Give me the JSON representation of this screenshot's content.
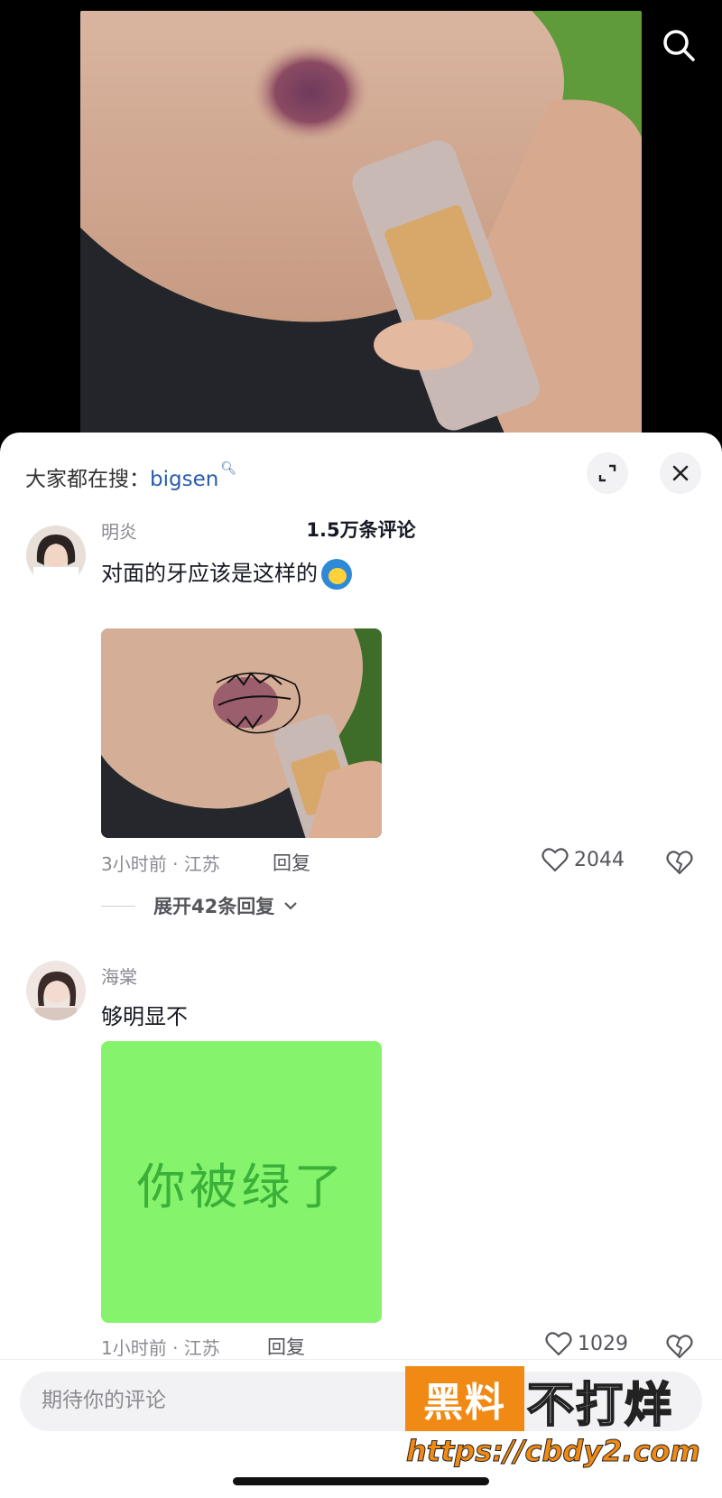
{
  "trending": {
    "prefix": "大家都在搜：",
    "keyword": "bigsen"
  },
  "comments_count": "1.5万条评论",
  "comments": [
    {
      "username": "明炎",
      "text": "对面的牙应该是这样的",
      "time_location": "3小时前 · 江苏",
      "reply_label": "回复",
      "likes": "2044",
      "expand_replies": "展开42条回复"
    },
    {
      "username": "海棠",
      "text": "够明显不",
      "image_text": "你被绿了",
      "time_location": "1小时前 · 江苏",
      "reply_label": "回复",
      "likes": "1029"
    }
  ],
  "input": {
    "placeholder": "期待你的评论"
  },
  "watermark": {
    "badge": "黑料",
    "text": "不打烊",
    "url": "https://cbdy2.com"
  },
  "colors": {
    "accent_link": "#2a5caa",
    "green_card": "#85f36b",
    "watermark_orange": "#f08a14"
  },
  "icons": [
    "search-icon",
    "expand-icon",
    "close-icon",
    "heart-icon",
    "broken-heart-icon",
    "chevron-down-icon"
  ]
}
